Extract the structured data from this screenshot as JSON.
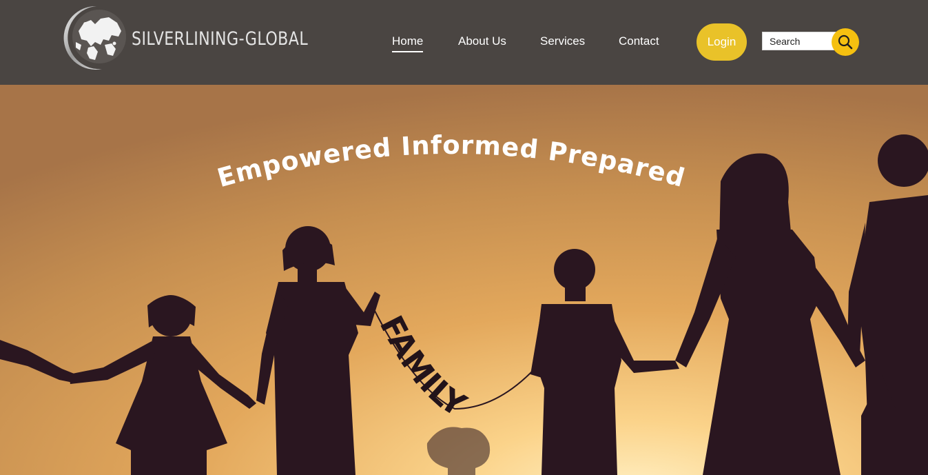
{
  "brand": {
    "name": "SILVERLINING-GLOBAL",
    "logo_icon": "globe-crescent-icon"
  },
  "nav": {
    "items": [
      {
        "label": "Home",
        "active": true
      },
      {
        "label": "About Us",
        "active": false
      },
      {
        "label": "Services",
        "active": false
      },
      {
        "label": "Contact",
        "active": false
      }
    ],
    "login_label": "Login"
  },
  "search": {
    "placeholder": "Search",
    "button_icon": "search-icon"
  },
  "hero": {
    "heading": "Empowered Informed Prepared",
    "banner_text": "FAMILY"
  },
  "colors": {
    "header_bg": "#4a4542",
    "accent_yellow": "#e9c229",
    "search_button": "#f5c010",
    "text_white": "#ffffff",
    "sky_top": "#c18a4c",
    "sky_glow": "#fbd38a",
    "silhouette": "#2a1620"
  }
}
